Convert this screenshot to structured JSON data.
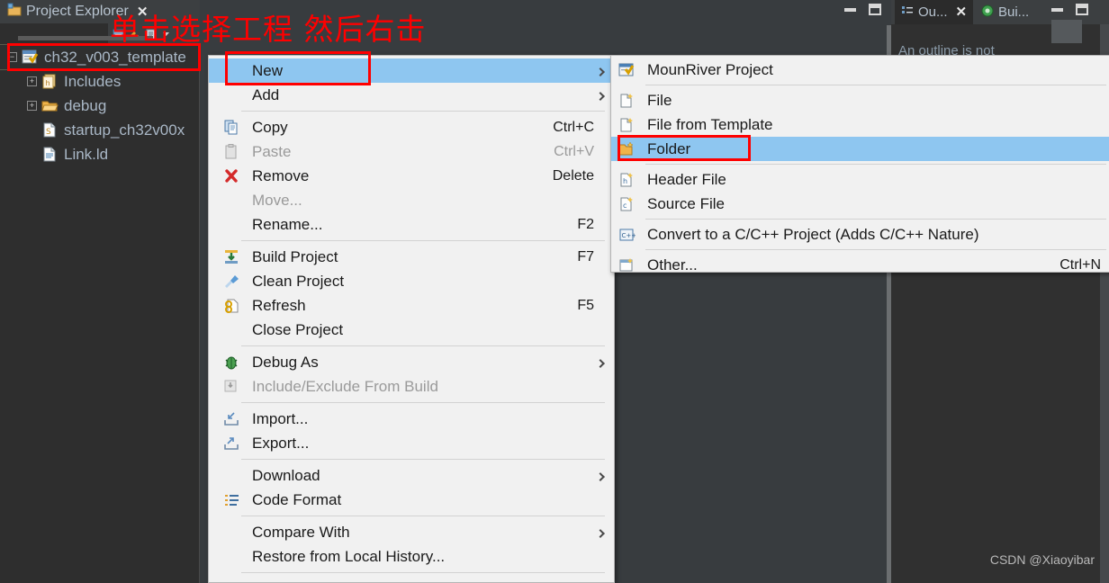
{
  "window": {
    "left_tab": {
      "label": "Project Explorer",
      "icon": "project-explorer-icon",
      "close": "✕"
    },
    "right_tabs": [
      {
        "label": "Ou...",
        "icon": "outline-icon",
        "close": "✕",
        "active": true
      },
      {
        "label": "Bui...",
        "icon": "build-target-icon",
        "close": "",
        "active": false
      }
    ],
    "outline_message": "An outline is not",
    "controls": {
      "minimize": "minimize-icon",
      "maximize": "maximize-icon"
    }
  },
  "tree": {
    "items": [
      {
        "label": "ch32_v003_template",
        "icon": "project-icon",
        "expander": "−",
        "indent": 8,
        "selected": true
      },
      {
        "label": "Includes",
        "icon": "includes-icon",
        "expander": "+",
        "indent": 30,
        "selected": false
      },
      {
        "label": "debug",
        "icon": "folder-icon",
        "expander": "+",
        "indent": 30,
        "selected": false
      },
      {
        "label": "startup_ch32v00x",
        "icon": "assembly-file-icon",
        "expander": "",
        "indent": 46,
        "selected": false
      },
      {
        "label": "Link.ld",
        "icon": "linker-file-icon",
        "expander": "",
        "indent": 46,
        "selected": false
      }
    ]
  },
  "context_menu": {
    "items": [
      {
        "label": "New",
        "accel": "",
        "icon": "",
        "arrow": true,
        "highlighted": true,
        "disabled": false
      },
      {
        "label": "Add",
        "accel": "",
        "icon": "",
        "arrow": true,
        "highlighted": false,
        "disabled": false
      },
      {
        "separator": true
      },
      {
        "label": "Copy",
        "accel": "Ctrl+C",
        "icon": "copy-icon",
        "arrow": false,
        "highlighted": false,
        "disabled": false
      },
      {
        "label": "Paste",
        "accel": "Ctrl+V",
        "icon": "paste-icon",
        "arrow": false,
        "highlighted": false,
        "disabled": true
      },
      {
        "label": "Remove",
        "accel": "Delete",
        "icon": "remove-icon",
        "arrow": false,
        "highlighted": false,
        "disabled": false
      },
      {
        "label": "Move...",
        "accel": "",
        "icon": "",
        "arrow": false,
        "highlighted": false,
        "disabled": true
      },
      {
        "label": "Rename...",
        "accel": "F2",
        "icon": "",
        "arrow": false,
        "highlighted": false,
        "disabled": false
      },
      {
        "separator": true
      },
      {
        "label": "Build Project",
        "accel": "F7",
        "icon": "build-icon",
        "arrow": false,
        "highlighted": false,
        "disabled": false
      },
      {
        "label": "Clean Project",
        "accel": "",
        "icon": "clean-icon",
        "arrow": false,
        "highlighted": false,
        "disabled": false
      },
      {
        "label": "Refresh",
        "accel": "F5",
        "icon": "refresh-icon",
        "arrow": false,
        "highlighted": false,
        "disabled": false
      },
      {
        "label": "Close Project",
        "accel": "",
        "icon": "",
        "arrow": false,
        "highlighted": false,
        "disabled": false
      },
      {
        "separator": true
      },
      {
        "label": "Debug As",
        "accel": "",
        "icon": "debug-icon",
        "arrow": true,
        "highlighted": false,
        "disabled": false
      },
      {
        "label": "Include/Exclude From Build",
        "accel": "",
        "icon": "include-exclude-icon",
        "arrow": false,
        "highlighted": false,
        "disabled": true
      },
      {
        "separator": true
      },
      {
        "label": "Import...",
        "accel": "",
        "icon": "import-icon",
        "arrow": false,
        "highlighted": false,
        "disabled": false
      },
      {
        "label": "Export...",
        "accel": "",
        "icon": "export-icon",
        "arrow": false,
        "highlighted": false,
        "disabled": false
      },
      {
        "separator": true
      },
      {
        "label": "Download",
        "accel": "",
        "icon": "",
        "arrow": true,
        "highlighted": false,
        "disabled": false
      },
      {
        "label": "Code Format",
        "accel": "",
        "icon": "code-format-icon",
        "arrow": false,
        "highlighted": false,
        "disabled": false
      },
      {
        "separator": true
      },
      {
        "label": "Compare With",
        "accel": "",
        "icon": "",
        "arrow": true,
        "highlighted": false,
        "disabled": false
      },
      {
        "label": "Restore from Local History...",
        "accel": "",
        "icon": "",
        "arrow": false,
        "highlighted": false,
        "disabled": false
      }
    ]
  },
  "submenu": {
    "items": [
      {
        "label": "MounRiver Project",
        "accel": "",
        "icon": "mounriver-project-icon",
        "highlighted": false
      },
      {
        "separator": true
      },
      {
        "label": "File",
        "accel": "",
        "icon": "new-file-icon",
        "highlighted": false
      },
      {
        "label": "File from Template",
        "accel": "",
        "icon": "file-template-icon",
        "highlighted": false
      },
      {
        "label": "Folder",
        "accel": "",
        "icon": "new-folder-icon",
        "highlighted": true
      },
      {
        "separator": true
      },
      {
        "label": "Header File",
        "accel": "",
        "icon": "header-file-icon",
        "highlighted": false
      },
      {
        "label": "Source File",
        "accel": "",
        "icon": "source-file-icon",
        "highlighted": false
      },
      {
        "separator": true
      },
      {
        "label": "Convert to a C/C++ Project (Adds C/C++ Nature)",
        "accel": "",
        "icon": "convert-cpp-icon",
        "highlighted": false
      },
      {
        "separator": true
      },
      {
        "label": "Other...",
        "accel": "Ctrl+N",
        "icon": "other-icon",
        "highlighted": false
      }
    ]
  },
  "annotations": {
    "instruction": "单击选择工程  然后右击",
    "color": "#ff0000",
    "boxes": [
      "project-node-box",
      "new-menu-item-box",
      "folder-menu-item-box"
    ]
  },
  "watermark": "CSDN @Xiaoyibar"
}
